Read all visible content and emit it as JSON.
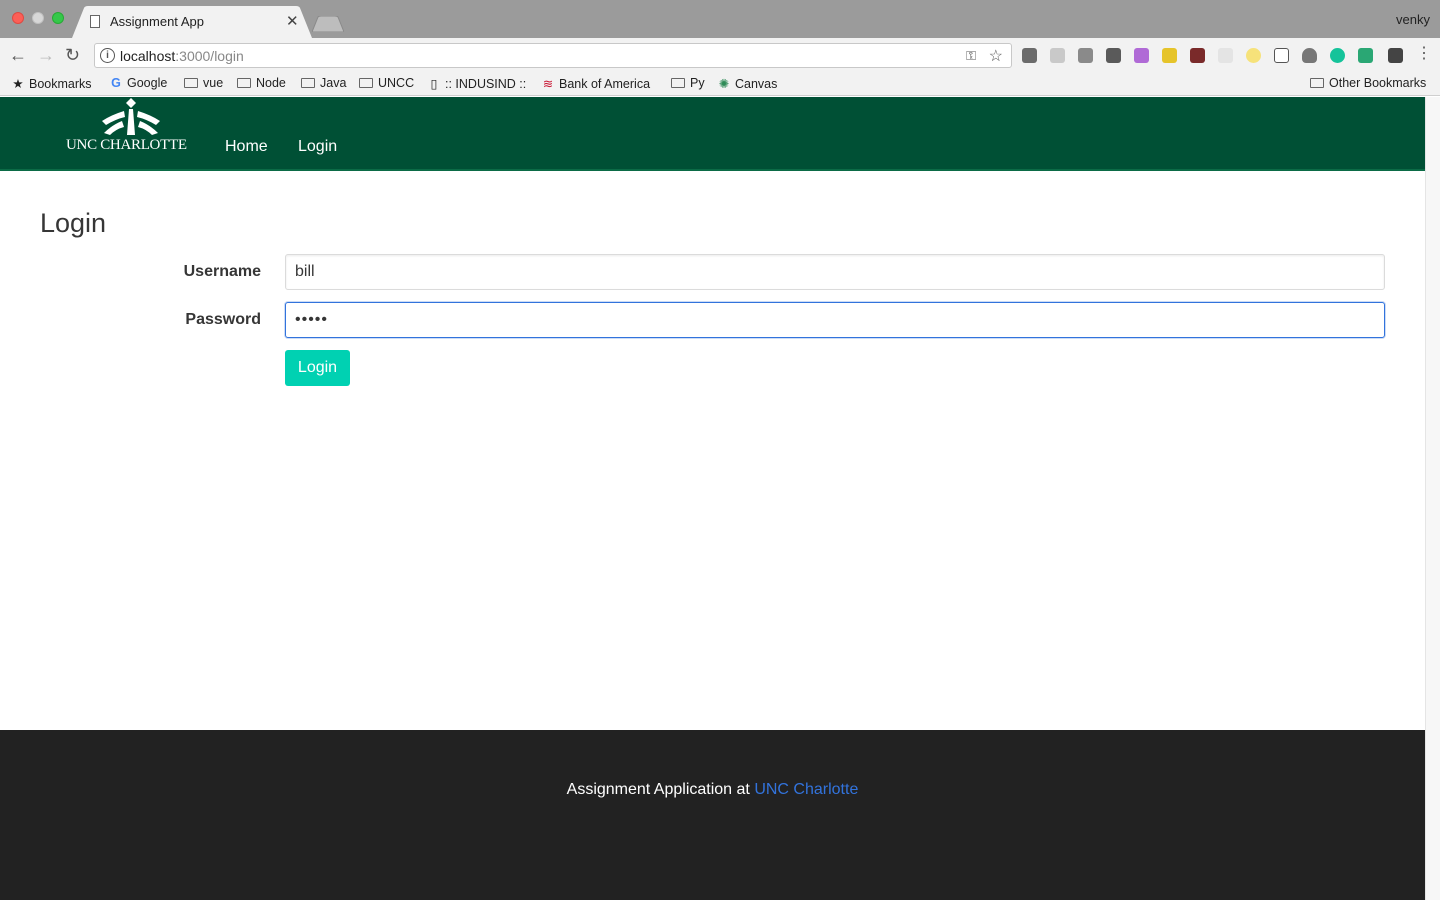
{
  "browser": {
    "tab_title": "Assignment App",
    "tab_close": "✕",
    "profile_name": "venky",
    "url_host": "localhost",
    "url_path": ":3000/login",
    "bookmarks": [
      {
        "label": "Bookmarks",
        "icon": "star-icon"
      },
      {
        "label": "Google",
        "icon": "google-icon"
      },
      {
        "label": "vue",
        "icon": "folder-icon"
      },
      {
        "label": "Node",
        "icon": "folder-icon"
      },
      {
        "label": "Java",
        "icon": "folder-icon"
      },
      {
        "label": "UNCC",
        "icon": "folder-icon"
      },
      {
        "label": ":: INDUSIND ::",
        "icon": "page-icon"
      },
      {
        "label": "Bank of America",
        "icon": "bofa-icon"
      },
      {
        "label": "Py",
        "icon": "folder-icon"
      },
      {
        "label": "Canvas",
        "icon": "canvas-icon"
      }
    ],
    "other_bookmarks": "Other Bookmarks"
  },
  "navbar": {
    "brand": "UNC CHARLOTTE",
    "links": [
      "Home",
      "Login"
    ]
  },
  "login": {
    "title": "Login",
    "username_label": "Username",
    "username_value": "bill",
    "password_label": "Password",
    "password_value": "•••••",
    "submit_label": "Login"
  },
  "footer": {
    "text": "Assignment Application at ",
    "link": "UNC Charlotte"
  },
  "colors": {
    "navbar": "#005035",
    "button": "#00d1b2",
    "link": "#3273dc",
    "footer": "#222222"
  }
}
